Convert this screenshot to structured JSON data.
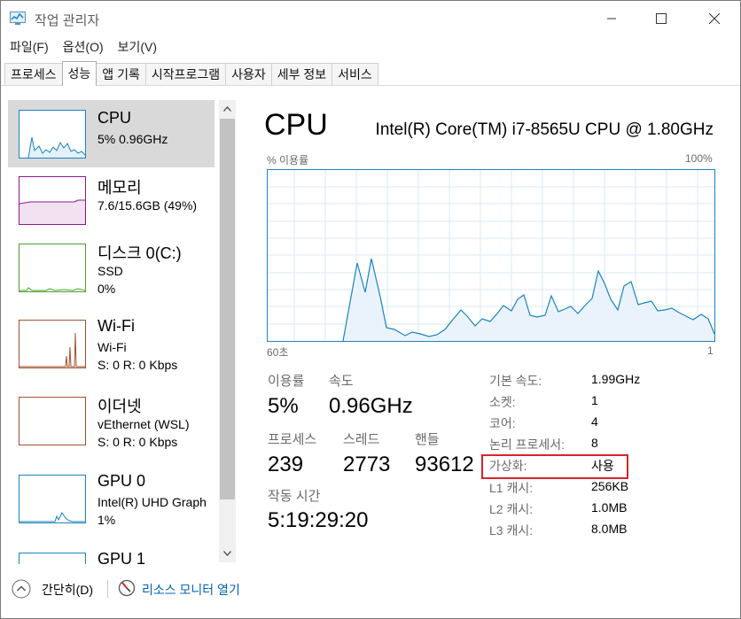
{
  "window": {
    "title": "작업 관리자"
  },
  "menu": [
    "파일(F)",
    "옵션(O)",
    "보기(V)"
  ],
  "tabs": [
    "프로세스",
    "성능",
    "앱 기록",
    "시작프로그램",
    "사용자",
    "세부 정보",
    "서비스"
  ],
  "sidebar": [
    {
      "title": "CPU",
      "sub1": "5% 0.96GHz",
      "color": "#1a84c1"
    },
    {
      "title": "메모리",
      "sub1": "7.6/15.6GB (49%)",
      "color": "#8b1a8b"
    },
    {
      "title": "디스크 0(C:)",
      "sub1": "SSD",
      "sub2": "0%",
      "color": "#4aa02c"
    },
    {
      "title": "Wi-Fi",
      "sub1": "Wi-Fi",
      "sub2": "S: 0 R: 0 Kbps",
      "color": "#a0522d"
    },
    {
      "title": "이더넷",
      "sub1": "vEthernet (WSL)",
      "sub2": "S: 0 R: 0 Kbps",
      "color": "#a0522d"
    },
    {
      "title": "GPU 0",
      "sub1": "Intel(R) UHD Graph",
      "sub2": "1%",
      "color": "#1a84c1"
    },
    {
      "title": "GPU 1",
      "color": "#1a84c1"
    }
  ],
  "main": {
    "title": "CPU",
    "model": "Intel(R) Core(TM) i7-8565U CPU @ 1.80GHz",
    "graph_label_left": "% 이용률",
    "graph_label_right": "100%",
    "graph_axis_left": "60초",
    "graph_axis_right": "1",
    "stats": {
      "usage_label": "이용률",
      "usage": "5%",
      "speed_label": "속도",
      "speed": "0.96GHz",
      "processes_label": "프로세스",
      "processes": "239",
      "threads_label": "스레드",
      "threads": "2773",
      "handles_label": "핸들",
      "handles": "93612",
      "uptime_label": "작동 시간",
      "uptime": "5:19:29:20"
    },
    "info": [
      {
        "label": "기본 속도:",
        "value": "1.99GHz"
      },
      {
        "label": "소켓:",
        "value": "1"
      },
      {
        "label": "코어:",
        "value": "4"
      },
      {
        "label": "논리 프로세서:",
        "value": "8"
      },
      {
        "label": "가상화:",
        "value": "사용"
      },
      {
        "label": "L1 캐시:",
        "value": "256KB"
      },
      {
        "label": "L2 캐시:",
        "value": "1.0MB"
      },
      {
        "label": "L3 캐시:",
        "value": "8.0MB"
      }
    ]
  },
  "footer": {
    "less": "간단히(D)",
    "resource_monitor": "리소스 모니터 열기"
  },
  "colors": {
    "accent": "#1a84c1",
    "highlight": "#d9242c",
    "link": "#0063b1"
  }
}
